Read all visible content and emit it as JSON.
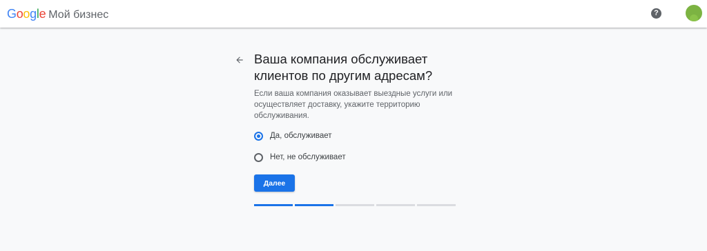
{
  "header": {
    "logo": {
      "letters": [
        {
          "char": "G",
          "color": "#4285F4"
        },
        {
          "char": "o",
          "color": "#EA4335"
        },
        {
          "char": "o",
          "color": "#FBBC05"
        },
        {
          "char": "g",
          "color": "#4285F4"
        },
        {
          "char": "l",
          "color": "#34A853"
        },
        {
          "char": "e",
          "color": "#EA4335"
        }
      ],
      "product": "Мой бизнес"
    },
    "help_icon": "?",
    "avatar_icon": "user-avatar"
  },
  "main": {
    "title": "Ваша компания обслуживает клиентов по другим адресам?",
    "description": "Если ваша компания оказывает выездные услуги или осуществляет доставку, укажите территорию обслуживания.",
    "options": [
      {
        "label": "Да, обслуживает",
        "checked": true
      },
      {
        "label": "Нет, не обслуживает",
        "checked": false
      }
    ],
    "next_button": "Далее",
    "progress": {
      "completed_steps": 2,
      "total_steps": 5
    }
  },
  "colors": {
    "accent": "#1a73e8",
    "background": "#f8f9fa",
    "progress_inactive": "#dadce0"
  }
}
